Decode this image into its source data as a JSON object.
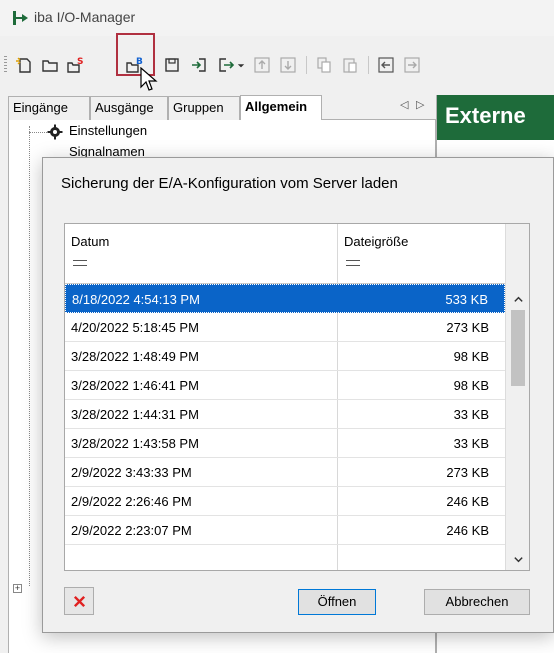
{
  "window": {
    "title": "iba I/O-Manager"
  },
  "tabs": [
    {
      "label": "Eingänge",
      "active": false
    },
    {
      "label": "Ausgänge",
      "active": false
    },
    {
      "label": "Gruppen",
      "active": false
    },
    {
      "label": "Allgemein",
      "active": true
    }
  ],
  "tree": {
    "items": [
      "Einstellungen",
      "Signalnamen"
    ]
  },
  "right_panel": {
    "header": "Externe"
  },
  "dialog": {
    "title": "Sicherung der E/A-Konfiguration vom Server laden",
    "columns": [
      "Datum",
      "Dateigröße"
    ],
    "filter_symbol": "=",
    "rows": [
      {
        "date": "8/18/2022 4:54:13 PM",
        "size": "533 KB",
        "selected": true
      },
      {
        "date": "4/20/2022 5:18:45 PM",
        "size": "273 KB"
      },
      {
        "date": "3/28/2022 1:48:49 PM",
        "size": "98 KB"
      },
      {
        "date": "3/28/2022 1:46:41 PM",
        "size": "98 KB"
      },
      {
        "date": "3/28/2022 1:44:31 PM",
        "size": "33 KB"
      },
      {
        "date": "3/28/2022 1:43:58 PM",
        "size": "33 KB"
      },
      {
        "date": "2/9/2022 3:43:33 PM",
        "size": "273 KB"
      },
      {
        "date": "2/9/2022 2:26:46 PM",
        "size": "246 KB"
      },
      {
        "date": "2/9/2022 2:23:07 PM",
        "size": "246 KB"
      }
    ],
    "buttons": {
      "open": "Öffnen",
      "cancel": "Abbrechen"
    }
  },
  "colors": {
    "accent_green": "#1e6b3a",
    "selection_blue": "#0a64c8",
    "highlight_red": "#b03040",
    "delete_red": "#e02020"
  }
}
